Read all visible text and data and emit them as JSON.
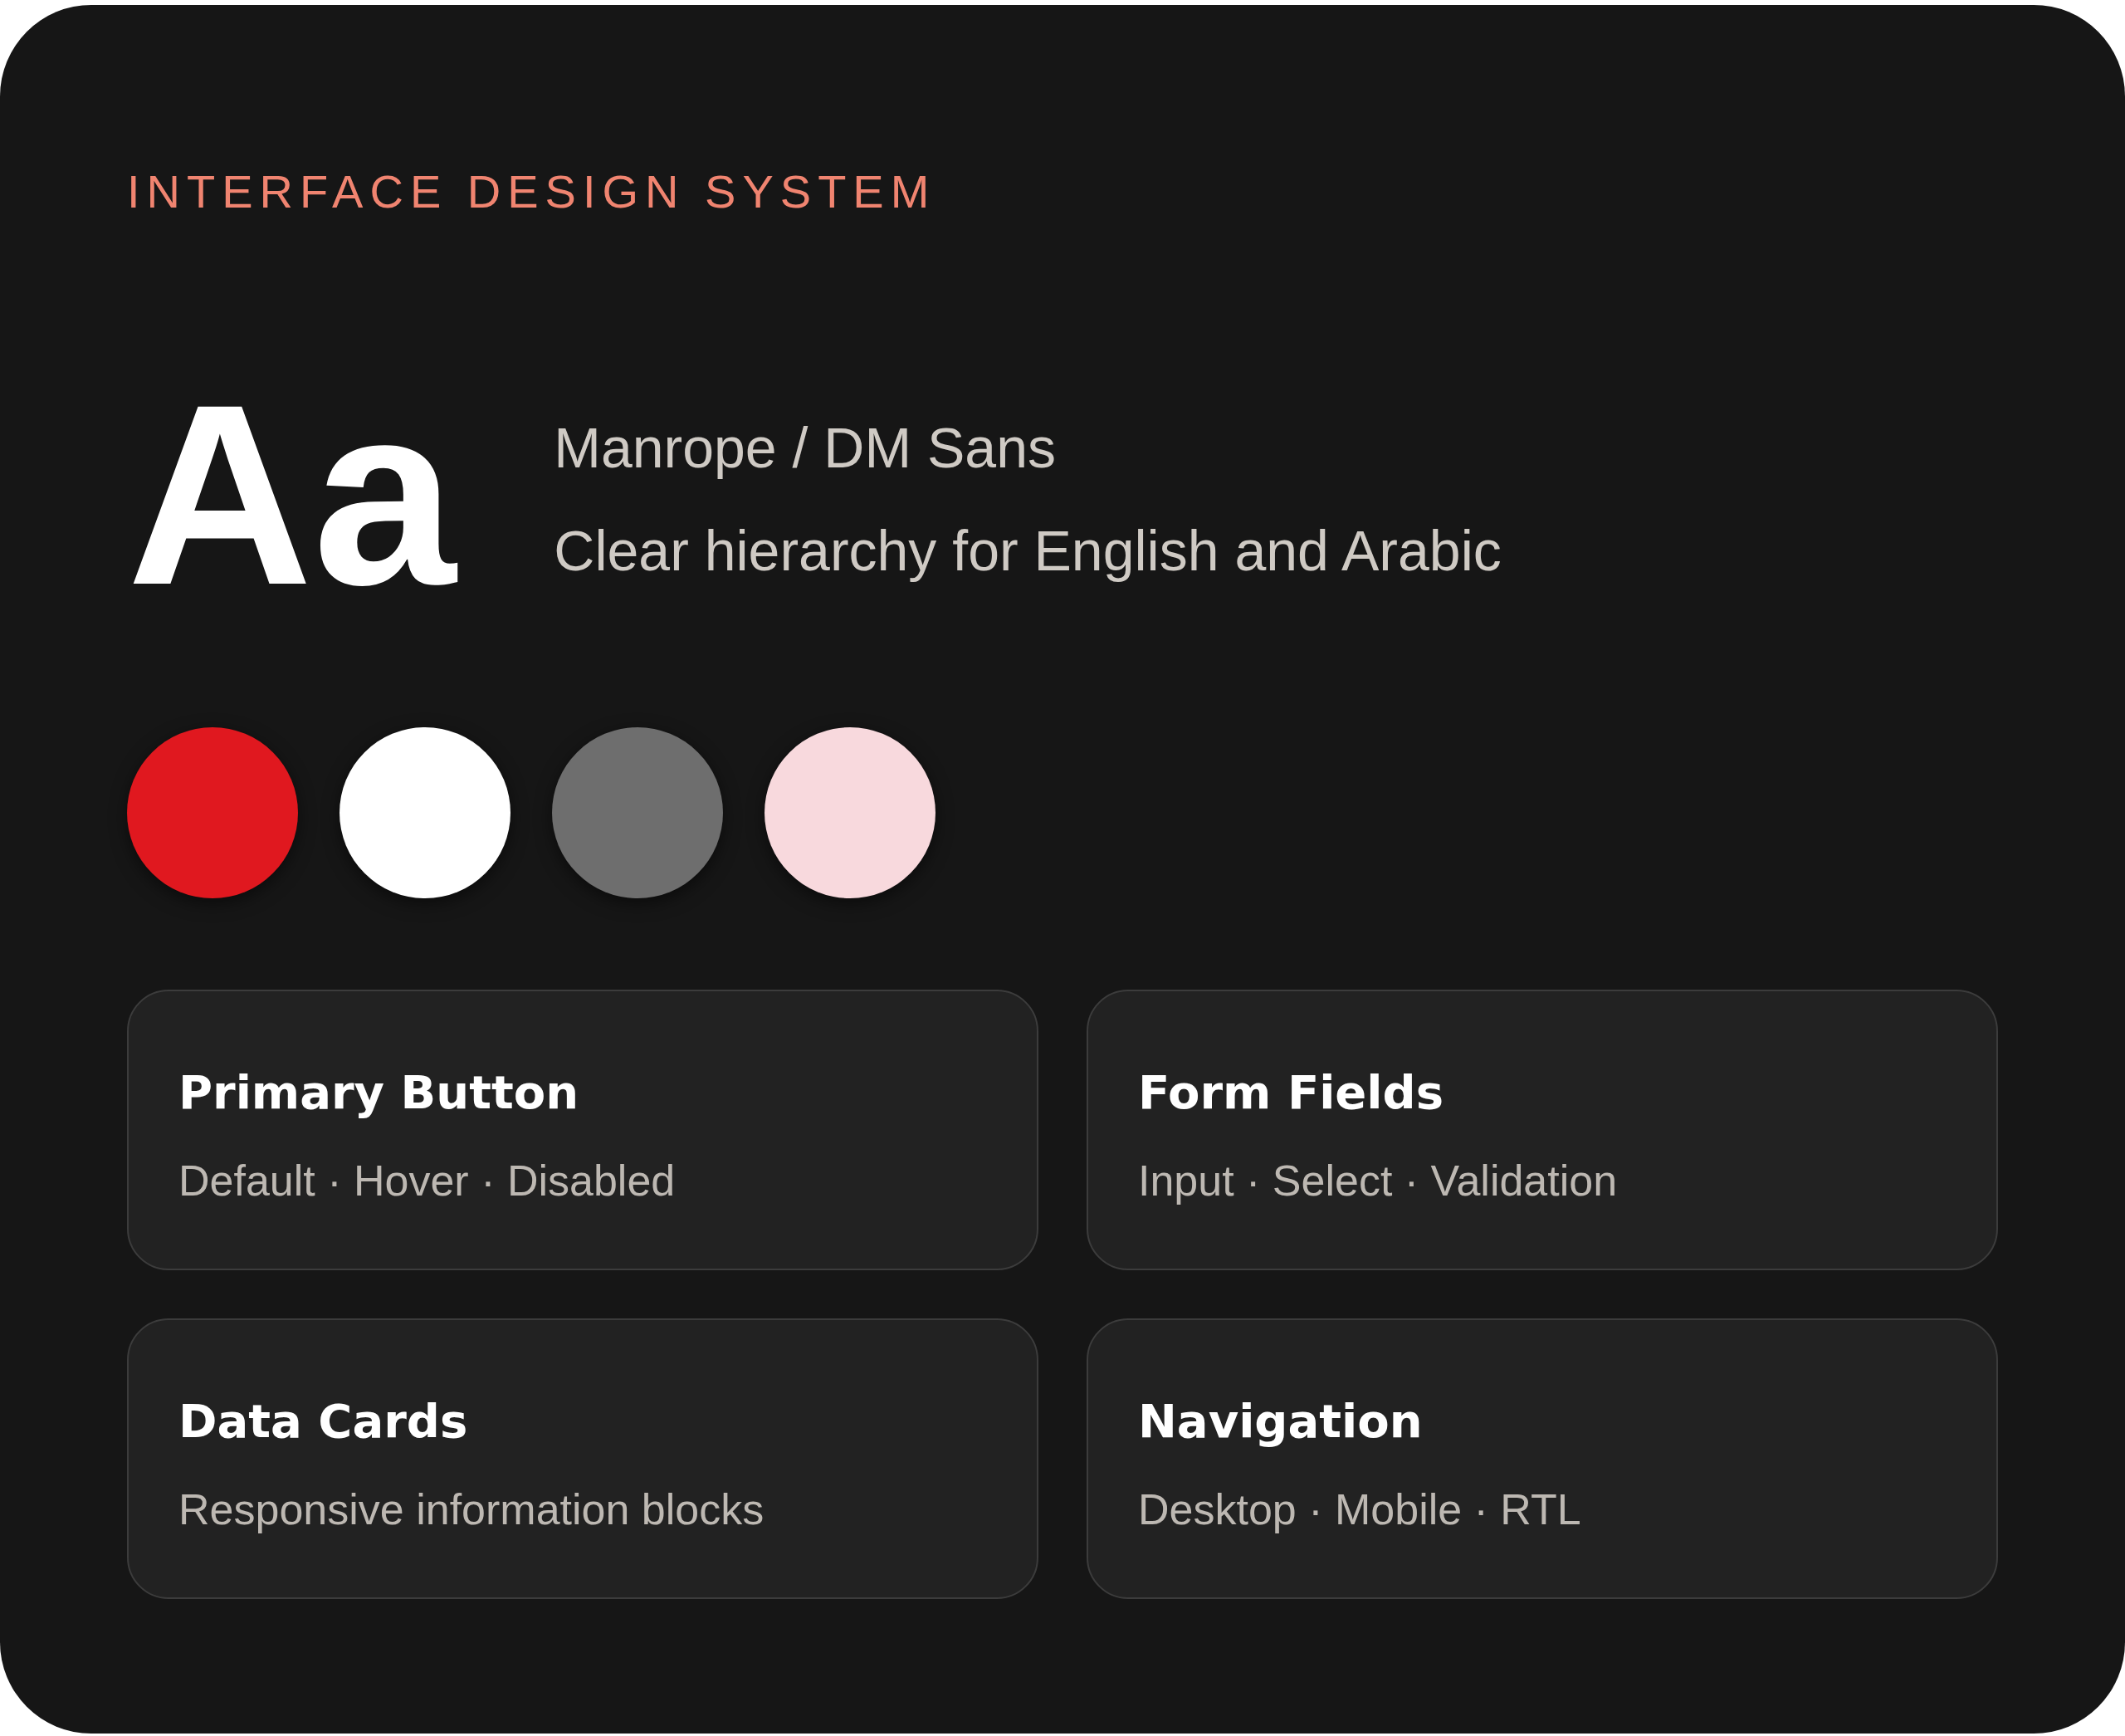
{
  "eyebrow": "INTERFACE DESIGN SYSTEM",
  "typography": {
    "specimen": "Aa",
    "font_names": "Manrope / DM Sans",
    "description": "Clear hierarchy for English and Arabic"
  },
  "swatches": [
    {
      "color": "#e0181f"
    },
    {
      "color": "#ffffff"
    },
    {
      "color": "#6e6e6e"
    },
    {
      "color": "#f8d9dd"
    }
  ],
  "components": [
    {
      "title": "Primary Button",
      "subtitle": "Default · Hover · Disabled"
    },
    {
      "title": "Form Fields",
      "subtitle": "Input · Select · Validation"
    },
    {
      "title": "Data Cards",
      "subtitle": "Responsive information blocks"
    },
    {
      "title": "Navigation",
      "subtitle": "Desktop · Mobile · RTL"
    }
  ]
}
